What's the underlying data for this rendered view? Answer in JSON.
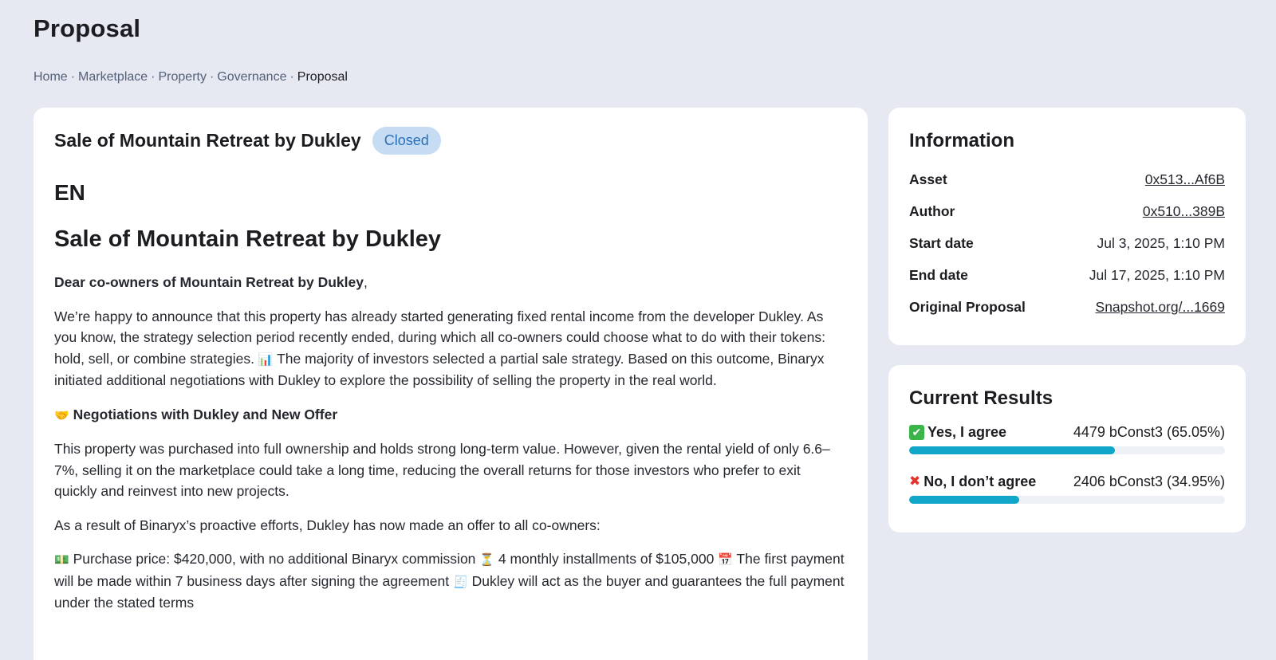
{
  "page": {
    "title": "Proposal"
  },
  "breadcrumb": [
    {
      "label": "Home"
    },
    {
      "label": "Marketplace"
    },
    {
      "label": "Property"
    },
    {
      "label": "Governance"
    },
    {
      "label": "Proposal"
    }
  ],
  "breadcrumb_separator": "·",
  "proposal": {
    "title": "Sale of Mountain Retreat by Dukley",
    "status": "Closed",
    "language": "EN",
    "content_title": "Sale of Mountain Retreat by Dukley",
    "greeting_bold": "Dear co-owners of Mountain Retreat by Dukley",
    "greeting_tail": ",",
    "para1_a": "We’re happy to announce that this property has already started generating fixed rental income from the developer Dukley. As you know, the strategy selection period recently ended, during which all co-owners could choose what to do with their tokens: hold, sell, or combine strategies.",
    "para1_emoji": "📊",
    "para1_b": "The majority of investors selected a partial sale strategy. Based on this outcome, Binaryx initiated additional negotiations with Dukley to explore the possibility of selling the property in the real world.",
    "section_emoji": "🤝",
    "section_heading": "Negotiations with Dukley and New Offer",
    "para2": "This property was purchased into full ownership and holds strong long-term value. However, given the rental yield of only 6.6–7%, selling it on the marketplace could take a long time, reducing the overall returns for those investors who prefer to exit quickly and reinvest into new projects.",
    "para3": "As a result of Binaryx’s proactive efforts, Dukley has now made an offer to all co-owners:",
    "offer_emoji1": "💵",
    "offer_text1": "Purchase price: $420,000, with no additional Binaryx commission",
    "offer_emoji2": "⏳",
    "offer_text2": "4 monthly installments of $105,000",
    "offer_emoji3": "📅",
    "offer_text3": "The first payment will be made within 7 business days after signing the agreement",
    "offer_emoji4": "🧾",
    "offer_text4": "Dukley will act as the buyer and guarantees the full payment under the stated terms"
  },
  "information": {
    "heading": "Information",
    "rows": [
      {
        "label": "Asset",
        "value": "0x513...Af6B"
      },
      {
        "label": "Author",
        "value": "0x510...389B"
      },
      {
        "label": "Start date",
        "value": "Jul 3, 2025, 1:10 PM"
      },
      {
        "label": "End date",
        "value": "Jul 17, 2025, 1:10 PM"
      },
      {
        "label": "Original Proposal",
        "value": "Snapshot.org/...1669"
      }
    ]
  },
  "results": {
    "heading": "Current Results",
    "options": [
      {
        "mark": "✔",
        "label": "Yes, I agree",
        "value": "4479 bConst3 (65.05%)",
        "fraction": 0.6505
      },
      {
        "mark": "✖",
        "label": "No, I don’t agree",
        "value": "2406 bConst3 (34.95%)",
        "fraction": 0.3495
      }
    ]
  },
  "colors": {
    "background": "#e6e9f1",
    "card": "#ffffff",
    "badge_bg": "#c5dcf3",
    "badge_text": "#2a6fb8",
    "progress": "#10a6c8",
    "yes_icon": "#3bb54a",
    "no_icon": "#e0342d"
  }
}
